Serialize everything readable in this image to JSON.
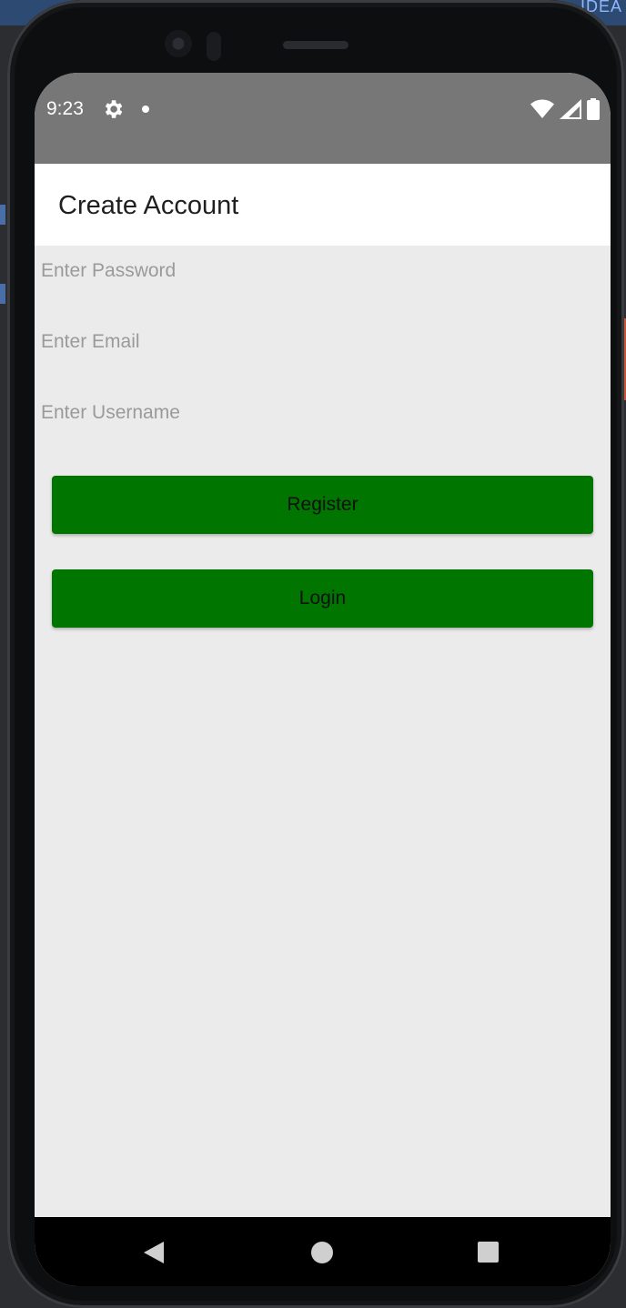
{
  "ide": {
    "corner_text": "IDEA"
  },
  "status_bar": {
    "time": "9:23",
    "icons": [
      "gear-icon",
      "notification-dot-icon",
      "wifi-icon",
      "signal-icon",
      "battery-icon"
    ]
  },
  "app_bar": {
    "title": "Create Account"
  },
  "form": {
    "password_placeholder": "Enter Password",
    "email_placeholder": "Enter Email",
    "username_placeholder": "Enter Username",
    "password_value": "",
    "email_value": "",
    "username_value": ""
  },
  "buttons": {
    "register_label": "Register",
    "login_label": "Login"
  },
  "nav_bar": {
    "icons": [
      "back-icon",
      "home-icon",
      "recents-icon"
    ]
  },
  "colors": {
    "primary_button": "#007500",
    "status_bar": "#777777",
    "content_background": "#ebebeb",
    "app_bar": "#ffffff",
    "navigation_bar": "#000000"
  }
}
